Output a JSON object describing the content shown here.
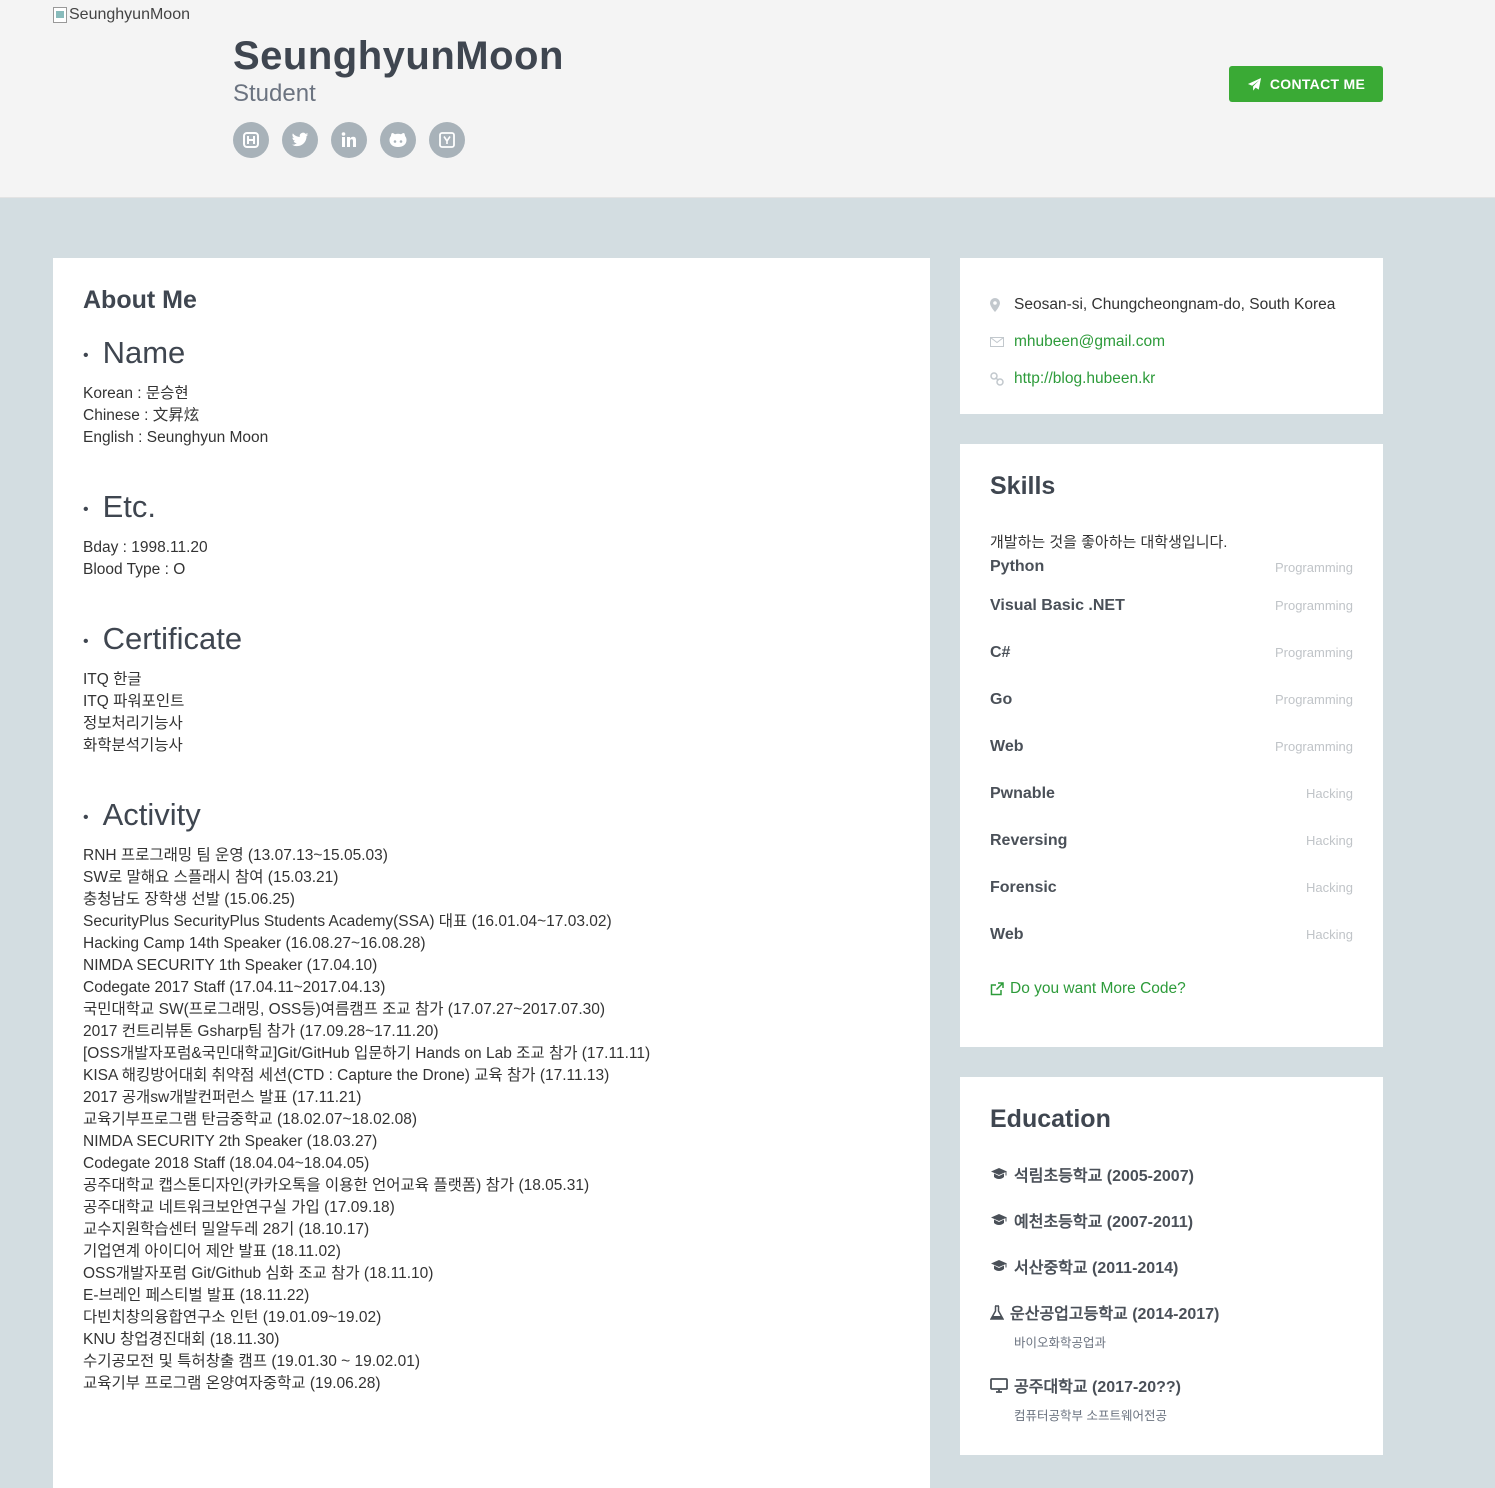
{
  "header": {
    "avatar_alt": "SeunghyunMoon",
    "name": "SeunghyunMoon",
    "tagline": "Student",
    "social_icons": [
      "hashnode-icon",
      "twitter-icon",
      "linkedin-icon",
      "github-icon",
      "hackernews-icon"
    ],
    "contact_label": "CONTACT ME",
    "accent_color": "#3aaa35"
  },
  "about": {
    "title": "About Me",
    "sections": [
      {
        "heading": "Name",
        "lines": [
          "Korean : 문승현",
          "Chinese : 文昇炫",
          "English : Seunghyun Moon"
        ]
      },
      {
        "heading": "Etc.",
        "lines": [
          "Bday : 1998.11.20",
          "Blood Type : O"
        ]
      },
      {
        "heading": "Certificate",
        "lines": [
          "ITQ 한글",
          "ITQ 파워포인트",
          "정보처리기능사",
          "화학분석기능사"
        ]
      },
      {
        "heading": "Activity",
        "lines": [
          "RNH 프로그래밍 팀 운영 (13.07.13~15.05.03)",
          "SW로 말해요 스플래시 참여 (15.03.21)",
          "충청남도 장학생 선발 (15.06.25)",
          "SecurityPlus SecurityPlus Students Academy(SSA) 대표 (16.01.04~17.03.02)",
          "Hacking Camp 14th Speaker (16.08.27~16.08.28)",
          "NIMDA SECURITY 1th Speaker (17.04.10)",
          "Codegate 2017 Staff (17.04.11~2017.04.13)",
          "국민대학교 SW(프로그래밍, OSS등)여름캠프 조교 참가 (17.07.27~2017.07.30)",
          "2017 컨트리뷰톤 Gsharp팀 참가 (17.09.28~17.11.20)",
          "[OSS개발자포럼&국민대학교]Git/GitHub 입문하기 Hands on Lab 조교 참가 (17.11.11)",
          "KISA 해킹방어대회 취약점 세션(CTD : Capture the Drone) 교육 참가 (17.11.13)",
          "2017 공개sw개발컨퍼런스 발표 (17.11.21)",
          "교육기부프로그램 탄금중학교 (18.02.07~18.02.08)",
          "NIMDA SECURITY 2th Speaker (18.03.27)",
          "Codegate 2018 Staff (18.04.04~18.04.05)",
          "공주대학교 캡스톤디자인(카카오톡을 이용한 언어교육 플랫폼) 참가 (18.05.31)",
          "공주대학교 네트워크보안연구실 가입 (17.09.18)",
          "교수지원학습센터 밀알두레 28기 (18.10.17)",
          "기업연계 아이디어 제안 발표 (18.11.02)",
          "OSS개발자포럼 Git/Github 심화 조교 참가 (18.11.10)",
          "E-브레인 페스티벌 발표 (18.11.22)",
          "다빈치창의융합연구소 인턴 (19.01.09~19.02)",
          "KNU 창업경진대회 (18.11.30)",
          "수기공모전 및 특허창출 캠프 (19.01.30 ~ 19.02.01)",
          "교육기부 프로그램 온양여자중학교 (19.06.28)"
        ]
      }
    ]
  },
  "info": {
    "location": "Seosan-si, Chungcheongnam-do, South Korea",
    "email": "mhubeen@gmail.com",
    "website": "http://blog.hubeen.kr"
  },
  "skills": {
    "title": "Skills",
    "intro": "개발하는 것을 좋아하는 대학생입니다.",
    "items": [
      {
        "name": "Python",
        "level": "Programming"
      },
      {
        "name": "Visual Basic .NET",
        "level": "Programming"
      },
      {
        "name": "C#",
        "level": "Programming"
      },
      {
        "name": "Go",
        "level": "Programming"
      },
      {
        "name": "Web",
        "level": "Programming"
      },
      {
        "name": "Pwnable",
        "level": "Hacking"
      },
      {
        "name": "Reversing",
        "level": "Hacking"
      },
      {
        "name": "Forensic",
        "level": "Hacking"
      },
      {
        "name": "Web",
        "level": "Hacking"
      }
    ],
    "more_link": "Do you want More Code?"
  },
  "education": {
    "title": "Education",
    "items": [
      {
        "icon": "graduation-cap-icon",
        "title": "석림초등학교 (2005-2007)",
        "sub": ""
      },
      {
        "icon": "graduation-cap-icon",
        "title": "예천초등학교 (2007-2011)",
        "sub": ""
      },
      {
        "icon": "graduation-cap-icon",
        "title": "서산중학교 (2011-2014)",
        "sub": ""
      },
      {
        "icon": "flask-icon",
        "title": "운산공업고등학교 (2014-2017)",
        "sub": "바이오화학공업과"
      },
      {
        "icon": "desktop-icon",
        "title": "공주대학교 (2017-20??)",
        "sub": "컴퓨터공학부 소프트웨어전공"
      }
    ]
  }
}
